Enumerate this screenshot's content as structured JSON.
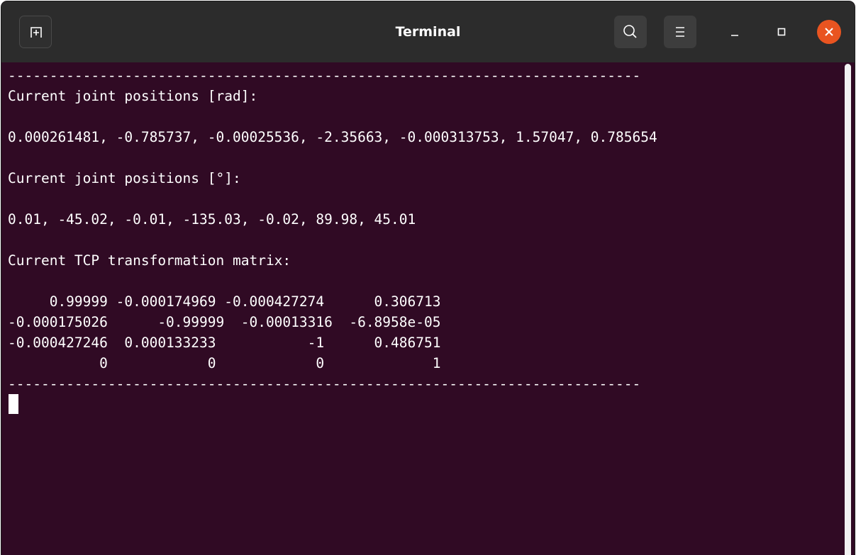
{
  "window": {
    "title": "Terminal",
    "accent_close": "#e95420",
    "background": "#300a24",
    "titlebar_color": "#2c2c2c"
  },
  "titlebar": {
    "new_tab_icon": "new-tab-icon",
    "search_icon": "search-icon",
    "menu_icon": "hamburger-menu-icon",
    "minimize_icon": "minimize-icon",
    "maximize_icon": "maximize-icon",
    "close_icon": "close-icon"
  },
  "terminal": {
    "lines": [
      "----------------------------------------------------------------------------",
      "Current joint positions [rad]:",
      "",
      "0.000261481, -0.785737, -0.00025536, -2.35663, -0.000313753, 1.57047, 0.785654",
      "",
      "Current joint positions [°]:",
      "",
      "0.01, -45.02, -0.01, -135.03, -0.02, 89.98, 45.01",
      "",
      "Current TCP transformation matrix:",
      "",
      "     0.99999 -0.000174969 -0.000427274      0.306713",
      "-0.000175026      -0.99999  -0.00013316  -6.8958e-05",
      "-0.000427246  0.000133233           -1      0.486751",
      "           0            0            0             1",
      "----------------------------------------------------------------------------"
    ]
  }
}
